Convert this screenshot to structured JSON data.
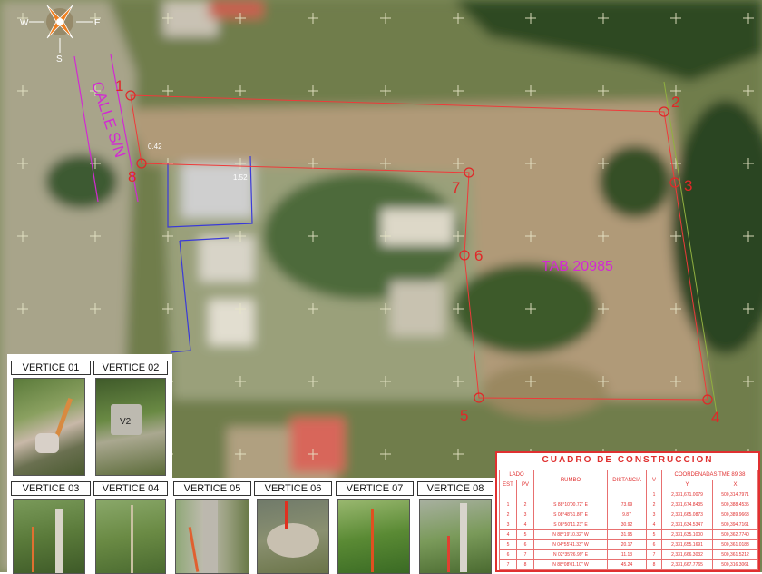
{
  "compass": {
    "west": "W",
    "east": "E",
    "south": "S"
  },
  "street_label": "CALLE S/N",
  "parcel_label": "TAB 20985",
  "dimensions": {
    "d1": "0.42",
    "d2": "1.52"
  },
  "vertex_numbers": [
    "1",
    "2",
    "3",
    "4",
    "5",
    "6",
    "7",
    "8"
  ],
  "photos": [
    "VERTICE 01",
    "VERTICE 02",
    "VERTICE 03",
    "VERTICE 04",
    "VERTICE 05",
    "VERTICE 06",
    "VERTICE 07",
    "VERTICE 08"
  ],
  "photo_marker": "V2",
  "table": {
    "title": "CUADRO DE CONSTRUCCION",
    "header_lado": "LADO",
    "header_est": "EST",
    "header_pv": "PV",
    "header_rumbo": "RUMBO",
    "header_distancia": "DISTANCIA",
    "header_v": "V",
    "header_coord": "COORDENADAS   TME  89  38",
    "header_y": "Y",
    "header_x": "X",
    "first_row": {
      "v": "1",
      "y": "2,331,671.0079",
      "x": "500,314.7971"
    },
    "rows": [
      {
        "est": "1",
        "pv": "2",
        "rumbo": "S  88°10'00.72\"  E",
        "dist": "73.69",
        "v": "2",
        "y": "2,331,674.8435",
        "x": "500,388.4535"
      },
      {
        "est": "2",
        "pv": "3",
        "rumbo": "S  08°48'51.86\"  E",
        "dist": "9.87",
        "v": "3",
        "y": "2,331,665.0873",
        "x": "500,389.9663"
      },
      {
        "est": "3",
        "pv": "4",
        "rumbo": "S  08°50'11.23\"  E",
        "dist": "30.92",
        "v": "4",
        "y": "2,331,634.5347",
        "x": "500,394.7161"
      },
      {
        "est": "4",
        "pv": "5",
        "rumbo": "N  88°19'10.32\"  W",
        "dist": "31.95",
        "v": "5",
        "y": "2,331,635.1000",
        "x": "500,362.7740"
      },
      {
        "est": "5",
        "pv": "6",
        "rumbo": "N  04°55'41.33\"  W",
        "dist": "20.17",
        "v": "6",
        "y": "2,331,655.1691",
        "x": "500,361.0183"
      },
      {
        "est": "6",
        "pv": "7",
        "rumbo": "N  02°35'26.99\"  E",
        "dist": "11.13",
        "v": "7",
        "y": "2,331,666.3032",
        "x": "500,361.5212"
      },
      {
        "est": "7",
        "pv": "8",
        "rumbo": "N  88°08'01.10\"  W",
        "dist": "45.24",
        "v": "8",
        "y": "2,331,667.7765",
        "x": "500,316.3061"
      }
    ]
  },
  "colors": {
    "vertex": "#e02828",
    "label": "#d22ad2",
    "boundary": "#ee3a3a",
    "construction": "#3a3ad8"
  }
}
